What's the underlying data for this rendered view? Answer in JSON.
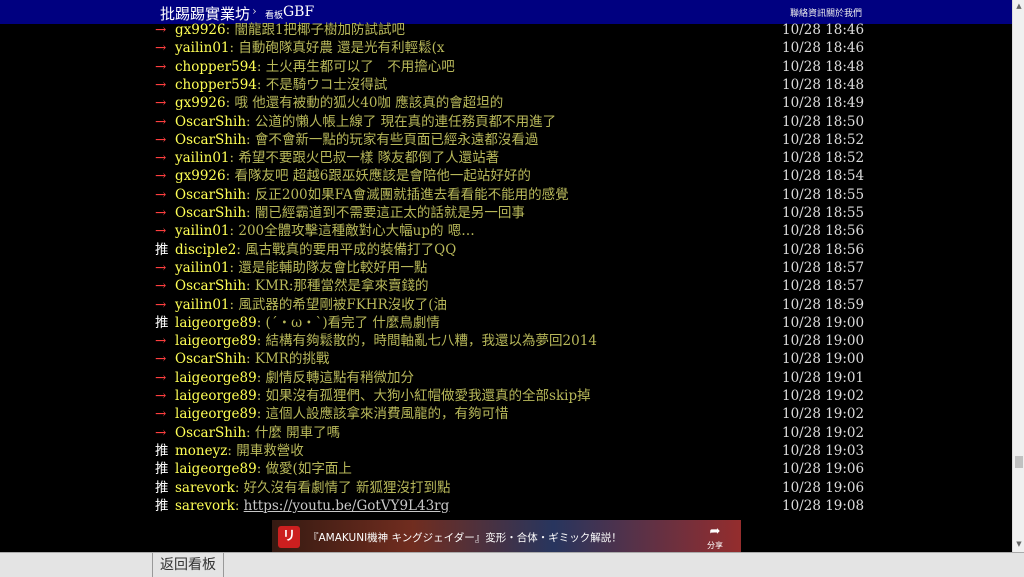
{
  "topbar": {
    "site_name": "批踢踢實業坊",
    "separator": "›",
    "board_label": "看板",
    "board_name": "GBF",
    "links": [
      "聯絡資訊",
      "關於我們"
    ]
  },
  "pushes": [
    {
      "tag": "→",
      "user": "gx9926",
      "content": ": 闇龍跟1把椰子樹加防試試吧",
      "time": "10/28 18:46"
    },
    {
      "tag": "→",
      "user": "yailin01",
      "content": ": 自動砲隊真好農 還是光有利輕鬆(x",
      "time": "10/28 18:46"
    },
    {
      "tag": "→",
      "user": "chopper594",
      "content": ": 土火再生都可以了　不用擔心吧",
      "time": "10/28 18:48"
    },
    {
      "tag": "→",
      "user": "chopper594",
      "content": ": 不是騎ウコ士沒得試",
      "time": "10/28 18:48"
    },
    {
      "tag": "→",
      "user": "gx9926",
      "content": ": 哦 他還有被動的狐火40咖 應該真的會超坦的",
      "time": "10/28 18:49"
    },
    {
      "tag": "→",
      "user": "OscarShih",
      "content": ": 公道的懶人帳上線了 現在真的連任務頁都不用進了",
      "time": "10/28 18:50"
    },
    {
      "tag": "→",
      "user": "OscarShih",
      "content": ": 會不會新一點的玩家有些頁面已經永遠都沒看過",
      "time": "10/28 18:52"
    },
    {
      "tag": "→",
      "user": "yailin01",
      "content": ": 希望不要跟火巴叔一樣 隊友都倒了人還站著",
      "time": "10/28 18:52"
    },
    {
      "tag": "→",
      "user": "gx9926",
      "content": ": 看隊友吧 超越6跟巫妖應該是會陪他一起站好好的",
      "time": "10/28 18:54"
    },
    {
      "tag": "→",
      "user": "OscarShih",
      "content": ": 反正200如果FA會滅團就插進去看看能不能用的感覺",
      "time": "10/28 18:55"
    },
    {
      "tag": "→",
      "user": "OscarShih",
      "content": ": 闇已經霸道到不需要這正太的話就是另一回事",
      "time": "10/28 18:55"
    },
    {
      "tag": "→",
      "user": "yailin01",
      "content": ": 200全體攻擊這種敵對心大幅up的 嗯…",
      "time": "10/28 18:56"
    },
    {
      "tag": "推",
      "user": "disciple2",
      "content": ": 風古戰真的要用平成的裝備打了QQ",
      "time": "10/28 18:56"
    },
    {
      "tag": "→",
      "user": "yailin01",
      "content": ": 還是能輔助隊友會比較好用一點",
      "time": "10/28 18:57"
    },
    {
      "tag": "→",
      "user": "OscarShih",
      "content": ": KMR:那種當然是拿來賣錢的",
      "time": "10/28 18:57"
    },
    {
      "tag": "→",
      "user": "yailin01",
      "content": ": 風武器的希望剛被FKHR沒收了(油",
      "time": "10/28 18:59"
    },
    {
      "tag": "推",
      "user": "laigeorge89",
      "content": ": (ˊ・ω・ˋ)看完了 什麼鳥劇情",
      "time": "10/28 19:00"
    },
    {
      "tag": "→",
      "user": "laigeorge89",
      "content": ": 結構有夠鬆散的，時間軸亂七八糟，我還以為夢回2014",
      "time": "10/28 19:00"
    },
    {
      "tag": "→",
      "user": "OscarShih",
      "content": ": KMR的挑戰",
      "time": "10/28 19:00"
    },
    {
      "tag": "→",
      "user": "laigeorge89",
      "content": ": 劇情反轉這點有稍微加分",
      "time": "10/28 19:01"
    },
    {
      "tag": "→",
      "user": "laigeorge89",
      "content": ": 如果沒有孤狸們、大狗小紅帽做愛我還真的全部skip掉",
      "time": "10/28 19:02"
    },
    {
      "tag": "→",
      "user": "laigeorge89",
      "content": ": 這個人設應該拿來消費風龍的，有夠可惜",
      "time": "10/28 19:02"
    },
    {
      "tag": "→",
      "user": "OscarShih",
      "content": ": 什麼 開車了嗎",
      "time": "10/28 19:02"
    },
    {
      "tag": "推",
      "user": "moneyz",
      "content": ": 開車救營收",
      "time": "10/28 19:03"
    },
    {
      "tag": "推",
      "user": "laigeorge89",
      "content": ": 做愛(如字面上",
      "time": "10/28 19:06"
    },
    {
      "tag": "推",
      "user": "sarevork",
      "content": ": 好久沒有看劇情了 新狐狸沒打到點",
      "time": "10/28 19:06"
    },
    {
      "tag": "推",
      "user": "sarevork",
      "content": ": ",
      "link": "https://youtu.be/GotVY9L43rg",
      "time": "10/28 19:08"
    }
  ],
  "embed": {
    "logo": "リ",
    "title": "『AMAKUNI機神 キングジェイダー』変形・合体・ギミック解説！",
    "share_label": "分享"
  },
  "bottombar": {
    "back_label": "返回看板"
  },
  "colors": {
    "topbar_bg": "#000080",
    "push_arrow": "#ff3f3f",
    "push_user": "#ffff55",
    "push_content": "#b8b85a",
    "push_time": "#dcdcdc"
  }
}
